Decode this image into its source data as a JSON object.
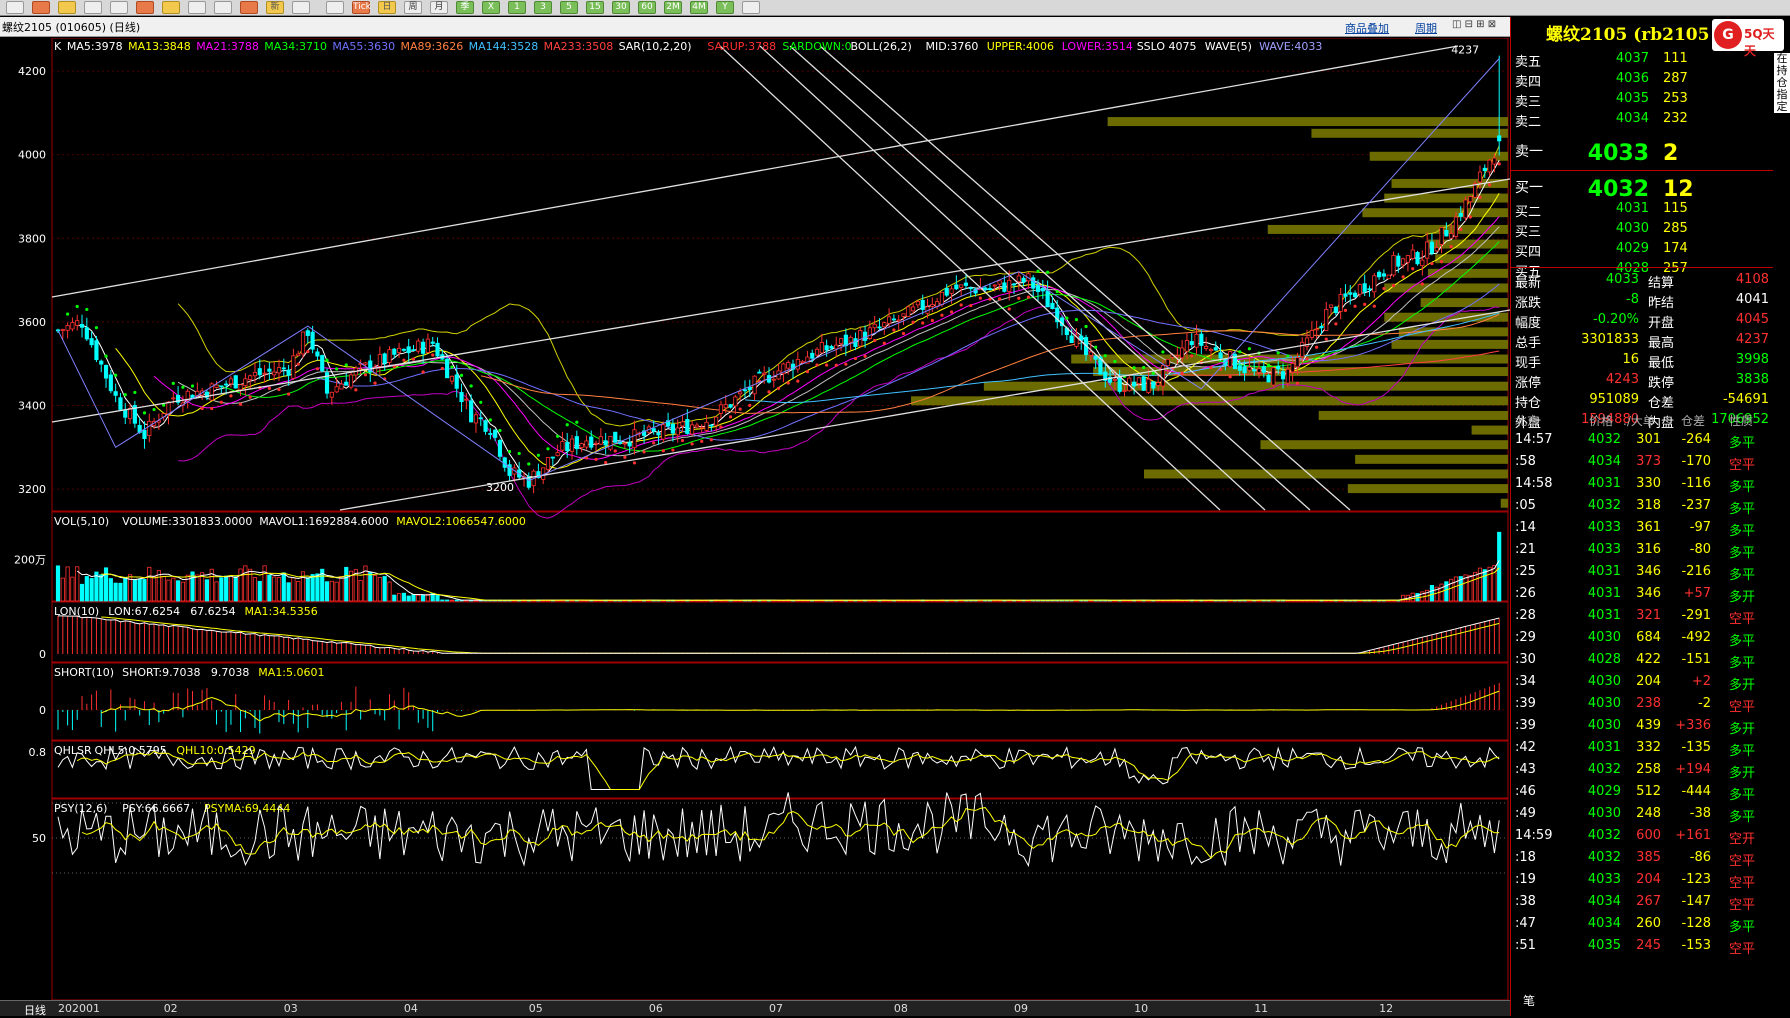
{
  "toolbar": {
    "buttons": [
      "home-icon",
      "forward-icon",
      "pad-icon",
      "list-icon",
      "search-icon",
      "zoom-icon",
      "news-icon",
      "pen-icon",
      "drop-icon",
      "tool-icon",
      "new-icon",
      "table-icon",
      "back-icon",
      "tick-icon",
      "day-icon",
      "week-icon",
      "month-icon",
      "quarter-icon",
      "X",
      "1",
      "3",
      "5",
      "15",
      "30",
      "60",
      "2M",
      "4M",
      "Y",
      "menu-icon"
    ],
    "labels": [
      "",
      "",
      "",
      "",
      "",
      "",
      "",
      "",
      "",
      "",
      "新",
      "",
      "",
      "Tick",
      "日",
      "周",
      "月",
      "季",
      "X",
      "1",
      "3",
      "5",
      "15",
      "30",
      "60",
      "2M",
      "4M",
      "Y",
      ""
    ]
  },
  "window": {
    "title": "螺纹2105 (010605) (日线)",
    "menu_items": [
      "商品叠加",
      "周期"
    ],
    "side_title": "螺纹2105 (rb2105",
    "logo": "5Q天天",
    "side_strip": "在持仓指定"
  },
  "indicators": {
    "main": [
      {
        "t": "K",
        "c": "#ffffff"
      },
      {
        "t": "MA5:3978",
        "c": "#ffffff"
      },
      {
        "t": "MA13:3848",
        "c": "#ffff00"
      },
      {
        "t": "MA21:3788",
        "c": "#ff00ff"
      },
      {
        "t": "MA34:3710",
        "c": "#00ff00"
      },
      {
        "t": "MA55:3630",
        "c": "#7070ff"
      },
      {
        "t": "MA89:3626",
        "c": "#ff8040"
      },
      {
        "t": "MA144:3528",
        "c": "#40c0ff"
      },
      {
        "t": "MA233:3508",
        "c": "#ff4040"
      },
      {
        "t": "SAR(10,2,20)",
        "c": "#ffffff"
      },
      {
        "t": "SARUP:3788",
        "c": "#ff3030"
      },
      {
        "t": "SARDOWN:0",
        "c": "#00ff00"
      },
      {
        "t": "BOLL(26,2)",
        "c": "#ffffff"
      },
      {
        "t": "MID:3760",
        "c": "#ffffff"
      },
      {
        "t": "UPPER:4006",
        "c": "#ffff00"
      },
      {
        "t": "LOWER:3514",
        "c": "#ff00ff"
      },
      {
        "t": "SSLO 4075",
        "c": "#ffffff"
      },
      {
        "t": "WAVE(5)",
        "c": "#ffffff"
      },
      {
        "t": "WAVE:4033",
        "c": "#a0a0ff"
      }
    ],
    "vol": [
      {
        "t": "VOL(5,10)",
        "c": "#ffffff"
      },
      {
        "t": "VOLUME:3301833.0000",
        "c": "#ffffff"
      },
      {
        "t": "MAVOL1:1692884.6000",
        "c": "#ffffff"
      },
      {
        "t": "MAVOL2:1066547.6000",
        "c": "#ffff00"
      }
    ],
    "lon": [
      {
        "t": "LON(10)",
        "c": "#ffffff"
      },
      {
        "t": "LON:67.6254",
        "c": "#ffffff"
      },
      {
        "t": "67.6254",
        "c": "#ffffff"
      },
      {
        "t": "MA1:34.5356",
        "c": "#ffff00"
      }
    ],
    "short": [
      {
        "t": "SHORT(10)",
        "c": "#ffffff"
      },
      {
        "t": "SHORT:9.7038",
        "c": "#ffffff"
      },
      {
        "t": "9.7038",
        "c": "#ffffff"
      },
      {
        "t": "MA1:5.0601",
        "c": "#ffff00"
      }
    ],
    "qhlsr": [
      {
        "t": "QHLSR",
        "c": "#ffffff"
      },
      {
        "t": "QHL5:0.5795",
        "c": "#ffffff"
      },
      {
        "t": "QHL10:0.5429",
        "c": "#ffff00"
      }
    ],
    "psy": [
      {
        "t": "PSY(12,6)",
        "c": "#ffffff"
      },
      {
        "t": "PSY:66.6667",
        "c": "#ffffff"
      },
      {
        "t": "PSYMA:69.4444",
        "c": "#ffff00"
      }
    ]
  },
  "axes": {
    "price_ticks": [
      "4200",
      "4000",
      "3800",
      "3600",
      "3400",
      "3200"
    ],
    "vol_tick": "200万",
    "lon_tick": "0",
    "short_tick": "0",
    "qhlsr_tick": "0.8",
    "psy_tick": "50",
    "months": [
      "202001",
      "02",
      "03",
      "04",
      "05",
      "06",
      "07",
      "08",
      "09",
      "10",
      "11",
      "12"
    ],
    "period_label": "日线"
  },
  "annotations": {
    "high_label": "4237",
    "low_label": "3200"
  },
  "order_book": {
    "asks": [
      {
        "label": "卖五",
        "price": "4037",
        "vol": "111"
      },
      {
        "label": "卖四",
        "price": "4036",
        "vol": "287"
      },
      {
        "label": "卖三",
        "price": "4035",
        "vol": "253"
      },
      {
        "label": "卖二",
        "price": "4034",
        "vol": "232"
      },
      {
        "label": "卖一",
        "price": "4033",
        "vol": "2"
      }
    ],
    "bids": [
      {
        "label": "买一",
        "price": "4032",
        "vol": "12"
      },
      {
        "label": "买二",
        "price": "4031",
        "vol": "115"
      },
      {
        "label": "买三",
        "price": "4030",
        "vol": "285"
      },
      {
        "label": "买四",
        "price": "4029",
        "vol": "174"
      },
      {
        "label": "买五",
        "price": "4028",
        "vol": "257"
      }
    ]
  },
  "stats": [
    {
      "l": "最新",
      "v": "4033",
      "vc": "#00ff00",
      "l2": "结算",
      "v2": "4108",
      "v2c": "#ff3030"
    },
    {
      "l": "涨跌",
      "v": "-8",
      "vc": "#00ff00",
      "l2": "昨结",
      "v2": "4041",
      "v2c": "#ffffff"
    },
    {
      "l": "幅度",
      "v": "-0.20%",
      "vc": "#00ff00",
      "l2": "开盘",
      "v2": "4045",
      "v2c": "#ff3030"
    },
    {
      "l": "总手",
      "v": "3301833",
      "vc": "#ffff00",
      "l2": "最高",
      "v2": "4237",
      "v2c": "#ff3030"
    },
    {
      "l": "现手",
      "v": "16",
      "vc": "#ffff00",
      "l2": "最低",
      "v2": "3998",
      "v2c": "#00ff00"
    },
    {
      "l": "涨停",
      "v": "4243",
      "vc": "#ff3030",
      "l2": "跌停",
      "v2": "3838",
      "v2c": "#00ff00"
    },
    {
      "l": "持仓",
      "v": "951089",
      "vc": "#ffff00",
      "l2": "仓差",
      "v2": "-54691",
      "v2c": "#ffff00"
    },
    {
      "l": "外盘",
      "v": "1594880",
      "vc": "#ff3030",
      "l2": "内盘",
      "v2": "1706952",
      "v2c": "#00ff00"
    }
  ],
  "ticks_header": [
    "北京",
    "价格",
    "./大单",
    "仓差",
    "性质"
  ],
  "ticks": [
    {
      "t": "14:57",
      "p": "4032",
      "v": "301",
      "d": "-264",
      "n": "多平"
    },
    {
      "t": ":58",
      "p": "4034",
      "v": "373",
      "d": "-170",
      "n": "空平"
    },
    {
      "t": "14:58",
      "p": "4031",
      "v": "330",
      "d": "-116",
      "n": "多平"
    },
    {
      "t": ":05",
      "p": "4032",
      "v": "318",
      "d": "-237",
      "n": "多平"
    },
    {
      "t": ":14",
      "p": "4033",
      "v": "361",
      "d": "-97",
      "n": "多平"
    },
    {
      "t": ":21",
      "p": "4033",
      "v": "316",
      "d": "-80",
      "n": "多平"
    },
    {
      "t": ":25",
      "p": "4031",
      "v": "346",
      "d": "-216",
      "n": "多平"
    },
    {
      "t": ":26",
      "p": "4031",
      "v": "346",
      "d": "+57",
      "n": "多开"
    },
    {
      "t": ":28",
      "p": "4031",
      "v": "321",
      "d": "-291",
      "n": "空平"
    },
    {
      "t": ":29",
      "p": "4030",
      "v": "684",
      "d": "-492",
      "n": "多平"
    },
    {
      "t": ":30",
      "p": "4028",
      "v": "422",
      "d": "-151",
      "n": "多平"
    },
    {
      "t": ":34",
      "p": "4030",
      "v": "204",
      "d": "+2",
      "n": "多开"
    },
    {
      "t": ":39",
      "p": "4030",
      "v": "238",
      "d": "-2",
      "n": "空平"
    },
    {
      "t": ":39",
      "p": "4030",
      "v": "439",
      "d": "+336",
      "n": "多开"
    },
    {
      "t": ":42",
      "p": "4031",
      "v": "332",
      "d": "-135",
      "n": "多平"
    },
    {
      "t": ":43",
      "p": "4032",
      "v": "258",
      "d": "+194",
      "n": "多开"
    },
    {
      "t": ":46",
      "p": "4029",
      "v": "512",
      "d": "-444",
      "n": "多平"
    },
    {
      "t": ":49",
      "p": "4030",
      "v": "248",
      "d": "-38",
      "n": "多平"
    },
    {
      "t": "14:59",
      "p": "4032",
      "v": "600",
      "d": "+161",
      "n": "空开"
    },
    {
      "t": ":18",
      "p": "4032",
      "v": "385",
      "d": "-86",
      "n": "空平"
    },
    {
      "t": ":19",
      "p": "4033",
      "v": "204",
      "d": "-123",
      "n": "空平"
    },
    {
      "t": ":38",
      "p": "4034",
      "v": "267",
      "d": "-147",
      "n": "空平"
    },
    {
      "t": ":47",
      "p": "4034",
      "v": "260",
      "d": "-128",
      "n": "多平"
    },
    {
      "t": ":51",
      "p": "4035",
      "v": "245",
      "d": "-153",
      "n": "空平"
    }
  ],
  "bottom_tab": "笔",
  "chart_data": {
    "type": "candlestick",
    "title": "螺纹2105 (010605) (日线)",
    "x_range": [
      "202001",
      "12"
    ],
    "ylim": [
      3150,
      4260
    ],
    "months": [
      "202001",
      "02",
      "03",
      "04",
      "05",
      "06",
      "07",
      "08",
      "09",
      "10",
      "11",
      "12"
    ],
    "close_anchors": [
      [
        0,
        3580
      ],
      [
        5,
        3600
      ],
      [
        12,
        3420
      ],
      [
        18,
        3330
      ],
      [
        24,
        3420
      ],
      [
        32,
        3440
      ],
      [
        40,
        3470
      ],
      [
        48,
        3490
      ],
      [
        52,
        3580
      ],
      [
        56,
        3430
      ],
      [
        62,
        3480
      ],
      [
        70,
        3520
      ],
      [
        78,
        3550
      ],
      [
        86,
        3380
      ],
      [
        90,
        3350
      ],
      [
        94,
        3240
      ],
      [
        98,
        3220
      ],
      [
        104,
        3290
      ],
      [
        110,
        3320
      ],
      [
        118,
        3320
      ],
      [
        128,
        3340
      ],
      [
        136,
        3370
      ],
      [
        146,
        3460
      ],
      [
        156,
        3520
      ],
      [
        166,
        3560
      ],
      [
        176,
        3610
      ],
      [
        186,
        3680
      ],
      [
        194,
        3680
      ],
      [
        202,
        3700
      ],
      [
        208,
        3620
      ],
      [
        214,
        3520
      ],
      [
        220,
        3450
      ],
      [
        228,
        3450
      ],
      [
        236,
        3560
      ],
      [
        244,
        3510
      ],
      [
        250,
        3470
      ],
      [
        256,
        3480
      ],
      [
        264,
        3620
      ],
      [
        272,
        3690
      ],
      [
        278,
        3740
      ],
      [
        284,
        3760
      ],
      [
        290,
        3830
      ],
      [
        294,
        3900
      ],
      [
        298,
        3990
      ],
      [
        300,
        4033
      ]
    ],
    "last_bar": {
      "open": 4045,
      "high": 4237,
      "low": 3998,
      "close": 4033
    },
    "volume_last": 3301833,
    "volume_tick": "200万",
    "volume_profile_prices": [
      4078,
      4050,
      3995,
      3930,
      3895,
      3860,
      3820,
      3785,
      3750,
      3715,
      3680,
      3645,
      3610,
      3575,
      3545,
      3510,
      3480,
      3445,
      3410,
      3375,
      3340,
      3305,
      3270,
      3235,
      3200,
      3165
    ],
    "volume_profile_lengths": [
      0.55,
      0.27,
      0.19,
      0.16,
      0.17,
      0.2,
      0.33,
      0.11,
      0.1,
      0.11,
      0.17,
      0.12,
      0.17,
      0.15,
      0.16,
      0.6,
      0.57,
      0.72,
      0.82,
      0.26,
      0.05,
      0.34,
      0.21,
      0.5,
      0.22,
      0.01
    ]
  }
}
